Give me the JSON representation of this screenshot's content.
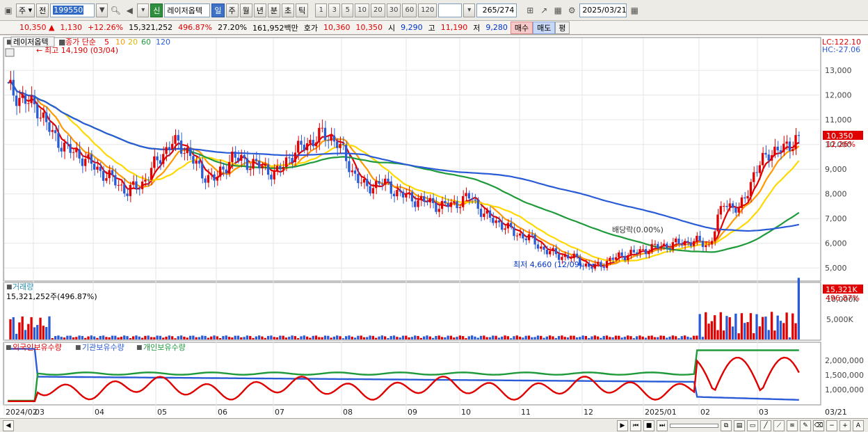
{
  "toolbar": {
    "market": "주",
    "prev_label": "전",
    "stock_code": "199550",
    "new_tag": "신",
    "stock_name": "레이저옵텍",
    "periods": [
      "일",
      "주",
      "월",
      "년",
      "분",
      "초",
      "틱"
    ],
    "selected_period": "일",
    "intervals": [
      "1",
      "3",
      "5",
      "10",
      "20",
      "30",
      "60",
      "120"
    ],
    "count": "265",
    "total": "/274",
    "date": "2025/03/21"
  },
  "quote": {
    "price": "10,350",
    "change": "1,130",
    "change_pct": "+12.26%",
    "volume": "15,321,252",
    "volume_pct": "496.87%",
    "turnover": "27.20%",
    "amount": "161,952백만",
    "hoga_label": "호가",
    "ask": "10,360",
    "bid": "10,350",
    "open_label": "시",
    "open": "9,290",
    "high_label": "고",
    "high": "11,190",
    "low_label": "저",
    "low": "9,280",
    "buy_label": "매수",
    "sell_label": "매도",
    "eval_label": "평"
  },
  "price_panel": {
    "name": "레이저옵텍",
    "ma_legend_prefix": "종가 단순",
    "ma_periods": [
      "5",
      "10",
      "20",
      "60",
      "120"
    ],
    "ma_colors": [
      "#e00000",
      "#ff9900",
      "#ffd800",
      "#1e9a3a",
      "#2a5bd7"
    ],
    "high_note": "최고 14,190 (03/04)",
    "low_note": "최저 4,660 (12/09)",
    "dividend_note": "배당락(0.00%)",
    "lc": "LC:122.10",
    "hc": "HC:-27.06",
    "y_ticks": [
      "13,000",
      "12,000",
      "11,000",
      "10,000",
      "9,000",
      "8,000",
      "7,000",
      "6,000",
      "5,000"
    ],
    "last_price_tag": "10,350",
    "last_pct_tag": "12.26%"
  },
  "volume_panel": {
    "title": "거래량",
    "value": "15,321,252주(496.87%)",
    "tag_value": "15,321K",
    "tag_pct": "496.87%",
    "y_ticks": [
      "10,000K",
      "5,000K"
    ]
  },
  "holdings_panel": {
    "legend": [
      "외국인보유수량",
      "기관보유수량",
      "개인보유수량"
    ],
    "legend_colors": [
      "#e00000",
      "#2a5bd7",
      "#1e9a3a"
    ],
    "y_ticks": [
      "2,000,000",
      "1,500,000",
      "1,000,000"
    ]
  },
  "x_axis": {
    "labels": [
      "2024/02",
      "03",
      "04",
      "05",
      "06",
      "07",
      "08",
      "09",
      "10",
      "11",
      "12",
      "2025/01",
      "02",
      "03"
    ],
    "right_label": "03/21"
  },
  "chart_data": {
    "type": "candlestick",
    "series_price": {
      "last": 10350,
      "high_max": 14190,
      "low_min": 4660,
      "approx_closes": [
        12300,
        11800,
        11500,
        10400,
        9800,
        9500,
        9000,
        8600,
        8100,
        8400,
        9300,
        10100,
        9800,
        8800,
        8600,
        9500,
        9300,
        9100,
        8800,
        9600,
        10000,
        10400,
        10200,
        9000,
        8200,
        8500,
        8100,
        7800,
        7700,
        7500,
        7600,
        7900,
        7100,
        6800,
        6400,
        6200,
        5700,
        5500,
        5400,
        5000,
        5200,
        5500,
        5600,
        5800,
        5900,
        6000,
        6100,
        5900,
        7700,
        7300,
        8800,
        9700,
        9800,
        10350
      ],
      "ylim": [
        4500,
        14300
      ]
    },
    "series_volume": {
      "last_k": 15321,
      "ylim_k": [
        0,
        14000
      ]
    },
    "series_holdings": {
      "ylim": [
        500000,
        2600000
      ]
    }
  }
}
